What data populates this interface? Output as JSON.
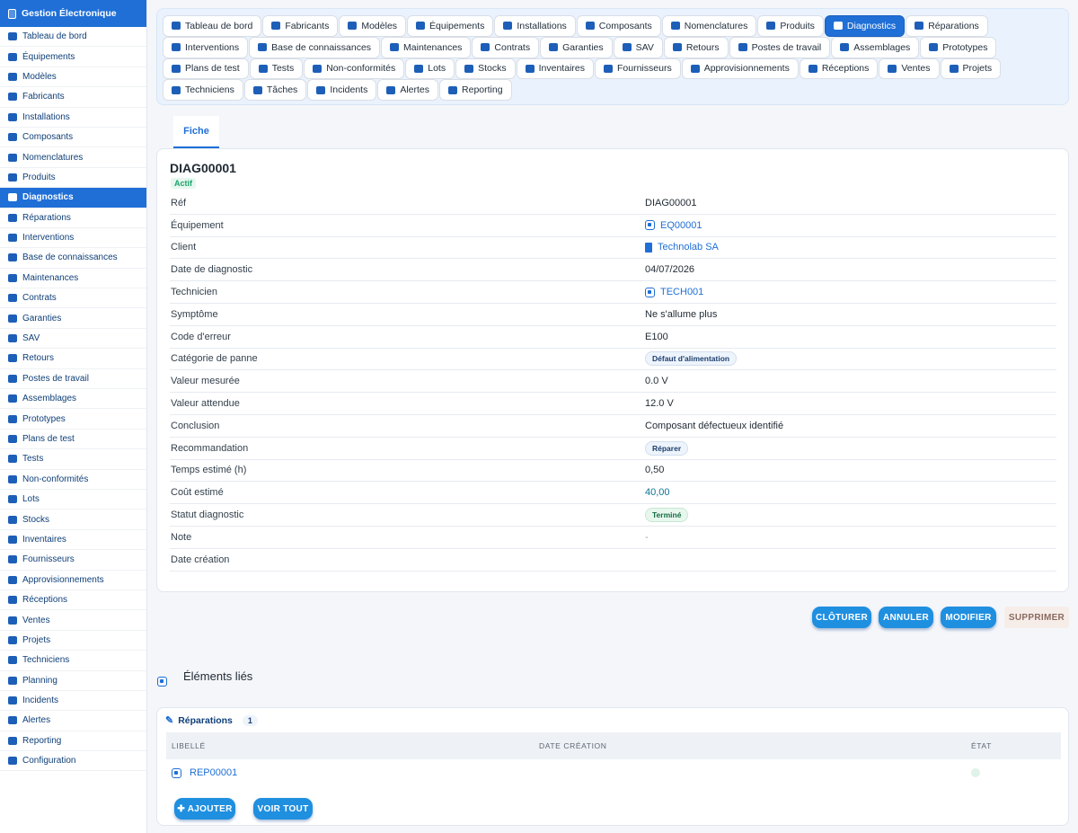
{
  "app": {
    "title": "Gestion Électronique"
  },
  "sidebar": {
    "items": [
      {
        "label": "Tableau de bord"
      },
      {
        "label": "Équipements"
      },
      {
        "label": "Modèles"
      },
      {
        "label": "Fabricants"
      },
      {
        "label": "Installations"
      },
      {
        "label": "Composants"
      },
      {
        "label": "Nomenclatures"
      },
      {
        "label": "Produits"
      },
      {
        "label": "Diagnostics",
        "active": true
      },
      {
        "label": "Réparations"
      },
      {
        "label": "Interventions"
      },
      {
        "label": "Base de connaissances"
      },
      {
        "label": "Maintenances"
      },
      {
        "label": "Contrats"
      },
      {
        "label": "Garanties"
      },
      {
        "label": "SAV"
      },
      {
        "label": "Retours"
      },
      {
        "label": "Postes de travail"
      },
      {
        "label": "Assemblages"
      },
      {
        "label": "Prototypes"
      },
      {
        "label": "Plans de test"
      },
      {
        "label": "Tests"
      },
      {
        "label": "Non-conformités"
      },
      {
        "label": "Lots"
      },
      {
        "label": "Stocks"
      },
      {
        "label": "Inventaires"
      },
      {
        "label": "Fournisseurs"
      },
      {
        "label": "Approvisionnements"
      },
      {
        "label": "Réceptions"
      },
      {
        "label": "Ventes"
      },
      {
        "label": "Projets"
      },
      {
        "label": "Techniciens"
      },
      {
        "label": "Planning"
      },
      {
        "label": "Incidents"
      },
      {
        "label": "Alertes"
      },
      {
        "label": "Reporting"
      },
      {
        "label": "Configuration"
      }
    ]
  },
  "module_tabs": [
    {
      "label": "Tableau de bord"
    },
    {
      "label": "Fabricants"
    },
    {
      "label": "Modèles"
    },
    {
      "label": "Équipements"
    },
    {
      "label": "Installations"
    },
    {
      "label": "Composants"
    },
    {
      "label": "Nomenclatures"
    },
    {
      "label": "Produits"
    },
    {
      "label": "Diagnostics",
      "active": true
    },
    {
      "label": "Réparations"
    },
    {
      "label": "Interventions"
    },
    {
      "label": "Base de connaissances"
    },
    {
      "label": "Maintenances"
    },
    {
      "label": "Contrats"
    },
    {
      "label": "Garanties"
    },
    {
      "label": "SAV"
    },
    {
      "label": "Retours"
    },
    {
      "label": "Postes de travail"
    },
    {
      "label": "Assemblages"
    },
    {
      "label": "Prototypes"
    },
    {
      "label": "Plans de test"
    },
    {
      "label": "Tests"
    },
    {
      "label": "Non-conformités"
    },
    {
      "label": "Lots"
    },
    {
      "label": "Stocks"
    },
    {
      "label": "Inventaires"
    },
    {
      "label": "Fournisseurs"
    },
    {
      "label": "Approvisionnements"
    },
    {
      "label": "Réceptions"
    },
    {
      "label": "Ventes"
    },
    {
      "label": "Projets"
    },
    {
      "label": "Techniciens"
    },
    {
      "label": "Tâches"
    },
    {
      "label": "Incidents"
    },
    {
      "label": "Alertes"
    },
    {
      "label": "Reporting"
    }
  ],
  "subtab": {
    "label": "Fiche"
  },
  "record": {
    "title": "DIAG00001",
    "status_badge": "Actif",
    "fields": [
      {
        "label": "Réf",
        "value": "DIAG00001",
        "kind": "text"
      },
      {
        "label": "Équipement",
        "value": "EQ00001",
        "kind": "link-chip"
      },
      {
        "label": "Client",
        "value": "Technolab SA",
        "kind": "link-building"
      },
      {
        "label": "Date de diagnostic",
        "value": "04/07/2026",
        "kind": "text"
      },
      {
        "label": "Technicien",
        "value": "TECH001",
        "kind": "link-chip"
      },
      {
        "label": "Symptôme",
        "value": "Ne s'allume plus",
        "kind": "text"
      },
      {
        "label": "Code d'erreur",
        "value": "E100",
        "kind": "text"
      },
      {
        "label": "Catégorie de panne",
        "value": "Défaut d'alimentation",
        "kind": "badge"
      },
      {
        "label": "Valeur mesurée",
        "value": "0.0 V",
        "kind": "text"
      },
      {
        "label": "Valeur attendue",
        "value": "12.0 V",
        "kind": "text"
      },
      {
        "label": "Conclusion",
        "value": "Composant défectueux identifié",
        "kind": "text"
      },
      {
        "label": "Recommandation",
        "value": "Réparer",
        "kind": "badge"
      },
      {
        "label": "Temps estimé (h)",
        "value": "0,50",
        "kind": "text"
      },
      {
        "label": "Coût estimé",
        "value": "40,00",
        "kind": "teal"
      },
      {
        "label": "Statut diagnostic",
        "value": "Terminé",
        "kind": "badge-green"
      },
      {
        "label": "Note",
        "value": "-",
        "kind": "muted"
      },
      {
        "label": "Date création",
        "value": "",
        "kind": "text"
      }
    ]
  },
  "actions": {
    "close": "CLÔTURER",
    "cancel": "ANNULER",
    "edit": "MODIFIER",
    "delete": "SUPPRIMER"
  },
  "linked": {
    "title": "Éléments liés",
    "repairs": {
      "title": "Réparations",
      "count": "1",
      "columns": [
        "LIBELLÉ",
        "DATE CRÉATION",
        "ÉTAT"
      ],
      "rows": [
        {
          "label": "REP00001",
          "date": "",
          "state": ""
        }
      ],
      "add": "AJOUTER",
      "view_all": "VOIR TOUT"
    }
  }
}
